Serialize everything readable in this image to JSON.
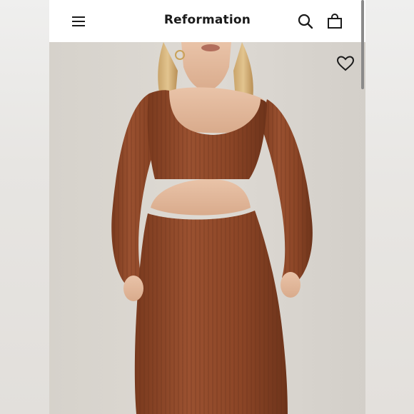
{
  "header": {
    "brand": "Reformation",
    "menu_icon": "hamburger-menu-icon",
    "search_icon": "search-icon",
    "bag_icon": "shopping-bag-icon"
  },
  "product_image": {
    "favorite_icon": "heart-icon"
  },
  "colors": {
    "dress": "#8b4526",
    "background": "#d9d5cf",
    "header_bg": "#ffffff",
    "text": "#1a1a1a"
  }
}
